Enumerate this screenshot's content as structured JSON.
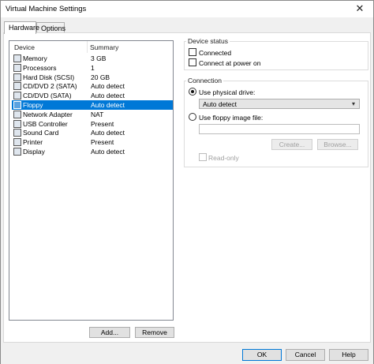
{
  "window": {
    "title": "Virtual Machine Settings",
    "close_glyph": "✕"
  },
  "tabs": [
    {
      "label": "Hardware",
      "active": true
    },
    {
      "label": "Options",
      "active": false
    }
  ],
  "device_list": {
    "columns": [
      "Device",
      "Summary"
    ],
    "rows": [
      {
        "icon": "memory-icon",
        "name": "Memory",
        "summary": "3 GB",
        "selected": false
      },
      {
        "icon": "processor-icon",
        "name": "Processors",
        "summary": "1",
        "selected": false
      },
      {
        "icon": "hard-disk-icon",
        "name": "Hard Disk (SCSI)",
        "summary": "20 GB",
        "selected": false
      },
      {
        "icon": "cd-dvd-icon",
        "name": "CD/DVD 2 (SATA)",
        "summary": "Auto detect",
        "selected": false
      },
      {
        "icon": "cd-dvd-icon",
        "name": "CD/DVD (SATA)",
        "summary": "Auto detect",
        "selected": false
      },
      {
        "icon": "floppy-icon",
        "name": "Floppy",
        "summary": "Auto detect",
        "selected": true
      },
      {
        "icon": "network-adapter-icon",
        "name": "Network Adapter",
        "summary": "NAT",
        "selected": false
      },
      {
        "icon": "usb-controller-icon",
        "name": "USB Controller",
        "summary": "Present",
        "selected": false
      },
      {
        "icon": "sound-card-icon",
        "name": "Sound Card",
        "summary": "Auto detect",
        "selected": false
      },
      {
        "icon": "printer-icon",
        "name": "Printer",
        "summary": "Present",
        "selected": false
      },
      {
        "icon": "display-icon",
        "name": "Display",
        "summary": "Auto detect",
        "selected": false
      }
    ],
    "add_label": "Add...",
    "remove_label": "Remove"
  },
  "device_status": {
    "legend": "Device status",
    "connected_label": "Connected",
    "connected": false,
    "connect_at_power_on_label": "Connect at power on",
    "connect_at_power_on": false
  },
  "connection": {
    "legend": "Connection",
    "use_physical_drive_label": "Use physical drive:",
    "use_physical_drive": true,
    "physical_drive_value": "Auto detect",
    "use_floppy_image_label": "Use floppy image file:",
    "use_floppy_image": false,
    "floppy_image_value": "",
    "create_label": "Create...",
    "browse_label": "Browse...",
    "read_only_label": "Read-only",
    "read_only": false
  },
  "footer": {
    "ok_label": "OK",
    "cancel_label": "Cancel",
    "help_label": "Help"
  }
}
